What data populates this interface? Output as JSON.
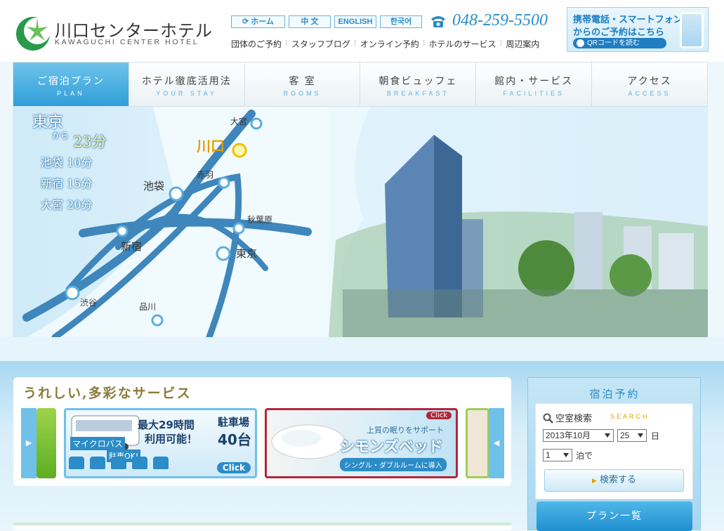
{
  "header": {
    "logo_title": "川口センターホテル",
    "logo_sub": "KAWAGUCHI CENTER HOTEL",
    "langs": [
      {
        "label": "⟳ ホーム"
      },
      {
        "label": "中 文"
      },
      {
        "label": "ENGLISH"
      },
      {
        "label": "한국어"
      }
    ],
    "phone": "048-259-5500",
    "sublinks": [
      "団体のご予約",
      "スタッフブログ",
      "オンライン予約",
      "ホテルのサービス",
      "周辺案内"
    ],
    "mobile": {
      "line1": "携帯電話・スマートフォン",
      "line2": "からのご予約はこちら",
      "qr": "QRコードを読む"
    }
  },
  "nav": [
    {
      "jp": "ご宿泊プラン",
      "en": "PLAN"
    },
    {
      "jp": "ホテル徹底活用法",
      "en": "YOUR STAY"
    },
    {
      "jp": "客 室",
      "en": "ROOMS"
    },
    {
      "jp": "朝食ビュッフェ",
      "en": "BREAKFAST"
    },
    {
      "jp": "館内・サービス",
      "en": "FACILITIES"
    },
    {
      "jp": "アクセス",
      "en": "ACCESS"
    }
  ],
  "hero": {
    "tokyo": "東京",
    "from": "から",
    "minutes": "23分",
    "times": [
      "池袋 10分",
      "新宿 15分",
      "大宮 20分"
    ],
    "stations": {
      "kawaguchi": "川口",
      "omiya": "大宮",
      "akabane": "赤羽",
      "ikebukuro": "池袋",
      "akihabara": "秋葉原",
      "shinjuku": "新宿",
      "tokyo": "東京",
      "shibuya": "渋谷",
      "shinagawa": "品川"
    }
  },
  "services": {
    "title": "うれしい,多彩なサービス",
    "bus": {
      "line1": "最大29時間",
      "line2": "利用可能！",
      "parking": "駐車場",
      "count": "40台",
      "micro": "マイクロバス",
      "micro2": "駐車OK!",
      "click": "Click"
    },
    "bed": {
      "sub": "上質の眠りをサポート",
      "title": "シモンズベッド",
      "tag": "シングル・ダブルルームに導入",
      "click": "Click"
    }
  },
  "booking": {
    "title": "宿泊予約",
    "search": "空室検索",
    "search_en": "SEARCH",
    "month": "2013年10月",
    "day": "25",
    "day_unit": "日",
    "nights": "1",
    "nights_unit": "泊で",
    "search_button": "検索する",
    "plan_button": "プラン一覧"
  }
}
